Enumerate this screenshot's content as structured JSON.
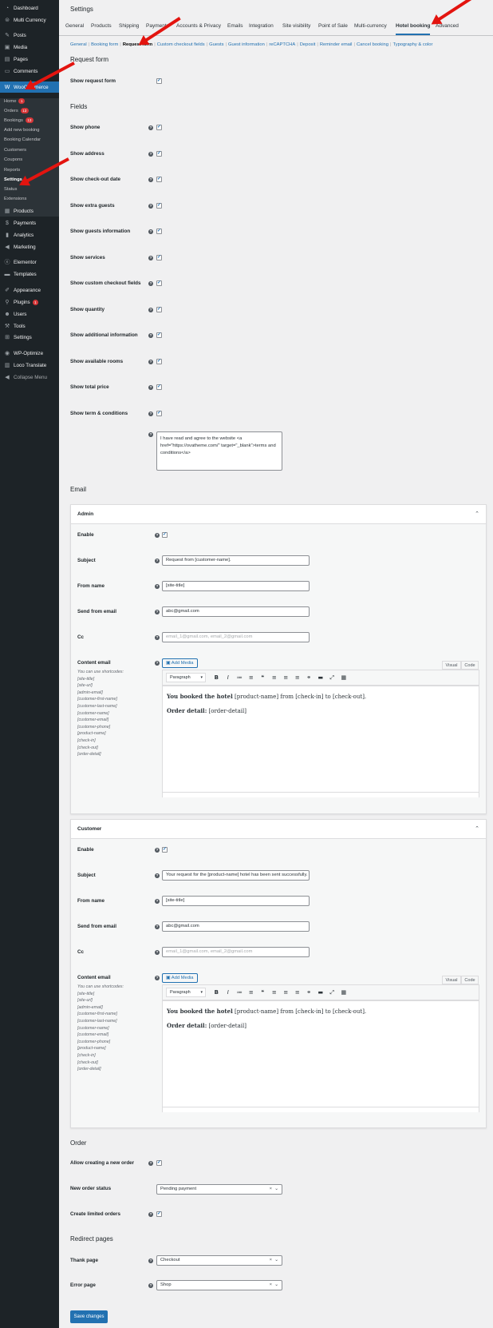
{
  "sidebar": {
    "top_items": [
      {
        "label": "Dashboard",
        "icon": "dashboard-icon",
        "glyph": "◔"
      },
      {
        "label": "Multi Currency",
        "icon": "currency-icon",
        "glyph": "⊜"
      },
      {
        "label": "Posts",
        "icon": "pin-icon",
        "glyph": "✎"
      },
      {
        "label": "Media",
        "icon": "media-icon",
        "glyph": "▣"
      },
      {
        "label": "Pages",
        "icon": "pages-icon",
        "glyph": "▤"
      },
      {
        "label": "Comments",
        "icon": "comment-icon",
        "glyph": "▭"
      },
      {
        "label": "WooCommerce",
        "icon": "woo-icon",
        "glyph": "W"
      }
    ],
    "sub_items": [
      {
        "label": "Home",
        "badge": "1"
      },
      {
        "label": "Orders",
        "badge": "13"
      },
      {
        "label": "Bookings",
        "badge": "13"
      },
      {
        "label": "Add new booking",
        "badge": ""
      },
      {
        "label": "Booking Calendar",
        "badge": ""
      },
      {
        "label": "Customers",
        "badge": ""
      },
      {
        "label": "Coupons",
        "badge": ""
      },
      {
        "label": "Reports",
        "badge": ""
      },
      {
        "label": "Settings",
        "badge": ""
      },
      {
        "label": "Status",
        "badge": ""
      },
      {
        "label": "Extensions",
        "badge": ""
      }
    ],
    "bottom_items": [
      {
        "label": "Products",
        "icon": "products-icon",
        "glyph": "▦"
      },
      {
        "label": "Payments",
        "icon": "payments-icon",
        "glyph": "$"
      },
      {
        "label": "Analytics",
        "icon": "analytics-icon",
        "glyph": "▮"
      },
      {
        "label": "Marketing",
        "icon": "megaphone-icon",
        "glyph": "◀"
      },
      {
        "label": "Elementor",
        "icon": "elementor-icon",
        "glyph": "ⓔ"
      },
      {
        "label": "Templates",
        "icon": "templates-icon",
        "glyph": "▬"
      },
      {
        "label": "Appearance",
        "icon": "brush-icon",
        "glyph": "✐"
      },
      {
        "label": "Plugins",
        "icon": "plugin-icon",
        "glyph": "⚲",
        "badge": "1"
      },
      {
        "label": "Users",
        "icon": "users-icon",
        "glyph": "☻"
      },
      {
        "label": "Tools",
        "icon": "tools-icon",
        "glyph": "⚒"
      },
      {
        "label": "Settings",
        "icon": "settings-icon",
        "glyph": "⊞"
      },
      {
        "label": "WP-Optimize",
        "icon": "wp-optimize-icon",
        "glyph": "◉"
      },
      {
        "label": "Loco Translate",
        "icon": "translate-icon",
        "glyph": "▥"
      },
      {
        "label": "Collapse Menu",
        "icon": "collapse-icon",
        "glyph": "◀"
      }
    ]
  },
  "header": {
    "title": "Settings"
  },
  "tabs": [
    "General",
    "Products",
    "Shipping",
    "Payments",
    "Accounts & Privacy",
    "Emails",
    "Integration",
    "Site visibility",
    "Point of Sale",
    "Multi-currency",
    "Hotel booking",
    "Advanced"
  ],
  "subtabs": [
    "General",
    "Booking form",
    "Request form",
    "Custom checkout fields",
    "Guests",
    "Guest information",
    "reCAPTCHA",
    "Deposit",
    "Reminder email",
    "Cancel booking",
    "Typography & color"
  ],
  "request_form": {
    "heading": "Request form",
    "show_label": "Show request form"
  },
  "fields": {
    "heading": "Fields",
    "items": [
      "Show phone",
      "Show address",
      "Show check-out date",
      "Show extra guests",
      "Show guests information",
      "Show services",
      "Show custom checkout fields",
      "Show quantity",
      "Show additional information",
      "Show available rooms",
      "Show total price",
      "Show term & conditions"
    ],
    "terms_text": "I have read and agree to the website <a href=\"https://ovatheme.com/\" target=\"_blank\">terms and conditions</a>"
  },
  "email": {
    "heading": "Email",
    "labels": {
      "enable": "Enable",
      "subject": "Subject",
      "from_name": "From name",
      "send_from": "Send from email",
      "cc": "Cc",
      "content": "Content email"
    },
    "shortcodes_intro": "You can use shortcodes:",
    "shortcodes": [
      "[site-title]",
      "[site-url]",
      "[admin-email]",
      "[customer-first-name]",
      "[customer-last-name]",
      "[customer-name]",
      "[customer-email]",
      "[customer-phone]",
      "[product-name]",
      "[check-in]",
      "[check-out]",
      "[order-detail]"
    ],
    "add_media": "Add Media",
    "visual": "Visual",
    "code": "Code",
    "paragraph": "Paragraph",
    "admin": {
      "title": "Admin",
      "subject": "Request from [customer-name].",
      "from_name": "[site-title]",
      "send_from": "abc@gmail.com",
      "cc_placeholder": "email_1@gmail.com, email_2@gmail.com",
      "line1_bold": "You booked the hotel",
      "line1_rest": " [product-name] from [check-in] to [check-out].",
      "line2_bold": "Order detail:",
      "line2_rest": " [order-detail]"
    },
    "customer": {
      "title": "Customer",
      "subject": "Your request for the [product-name] hotel has been sent successfully.",
      "from_name": "[site-title]",
      "send_from": "abc@gmail.com",
      "cc_placeholder": "email_1@gmail.com, email_2@gmail.com",
      "line1_bold": "You booked the hotel",
      "line1_rest": " [product-name] from [check-in] to [check-out].",
      "line2_bold": "Order detail:",
      "line2_rest": " [order-detail]"
    }
  },
  "order": {
    "heading": "Order",
    "allow_new": "Allow creating a new order",
    "status_label": "New order status",
    "status_value": "Pending payment",
    "limited": "Create limited orders"
  },
  "redirect": {
    "heading": "Redirect pages",
    "thank_label": "Thank page",
    "thank_value": "Checkout",
    "error_label": "Error page",
    "error_value": "Shop"
  },
  "save_label": "Save changes",
  "colors": {
    "accent": "#2271b1",
    "sidebar": "#1d2327",
    "arrow": "#e3140f"
  }
}
